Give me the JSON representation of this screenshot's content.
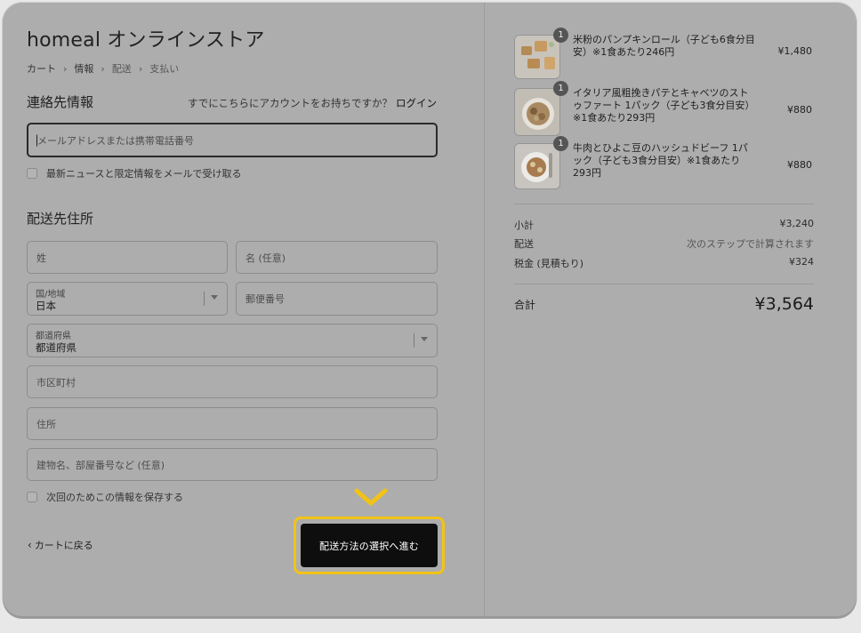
{
  "store": {
    "title": "homeal オンラインストア"
  },
  "breadcrumb": [
    "カート",
    "情報",
    "配送",
    "支払い"
  ],
  "contact": {
    "heading": "連絡先情報",
    "login_prompt": "すでにこちらにアカウントをお持ちですか？",
    "login_link": "ログイン",
    "email_placeholder": "メールアドレスまたは携帯電話番号",
    "newsletter_label": "最新ニュースと限定情報をメールで受け取る"
  },
  "shipping": {
    "heading": "配送先住所",
    "last_name_placeholder": "姓",
    "first_name_placeholder": "名 (任意)",
    "country_label": "国/地域",
    "country_value": "日本",
    "postal_placeholder": "郵便番号",
    "prefecture_label": "都道府県",
    "prefecture_value": "都道府県",
    "city_placeholder": "市区町村",
    "address_placeholder": "住所",
    "building_placeholder": "建物名、部屋番号など (任意)",
    "save_info_label": "次回のためこの情報を保存する"
  },
  "footer": {
    "back_label": "カートに戻る",
    "continue_label": "配送方法の選択へ進む"
  },
  "cart": {
    "items": [
      {
        "qty": "1",
        "name": "米粉のパンプキンロール（子ども6食分目安）※1食あたり246円",
        "price": "¥1,480"
      },
      {
        "qty": "1",
        "name": "イタリア風粗挽きパテとキャベツのストゥファート 1パック（子ども3食分目安）※1食あたり293円",
        "price": "¥880"
      },
      {
        "qty": "1",
        "name": "牛肉とひよこ豆のハッシュドビーフ 1パック（子ども3食分目安）※1食あたり293円",
        "price": "¥880"
      }
    ]
  },
  "summary": {
    "subtotal_label": "小計",
    "subtotal_value": "¥3,240",
    "shipping_label": "配送",
    "shipping_value": "次のステップで計算されます",
    "tax_label": "税金 (見積もり)",
    "tax_value": "¥324",
    "total_label": "合計",
    "total_value": "¥3,564"
  },
  "colors": {
    "highlight": "#f2c316",
    "cta_bg": "#0e0e0e",
    "overlay": "#adadad"
  }
}
